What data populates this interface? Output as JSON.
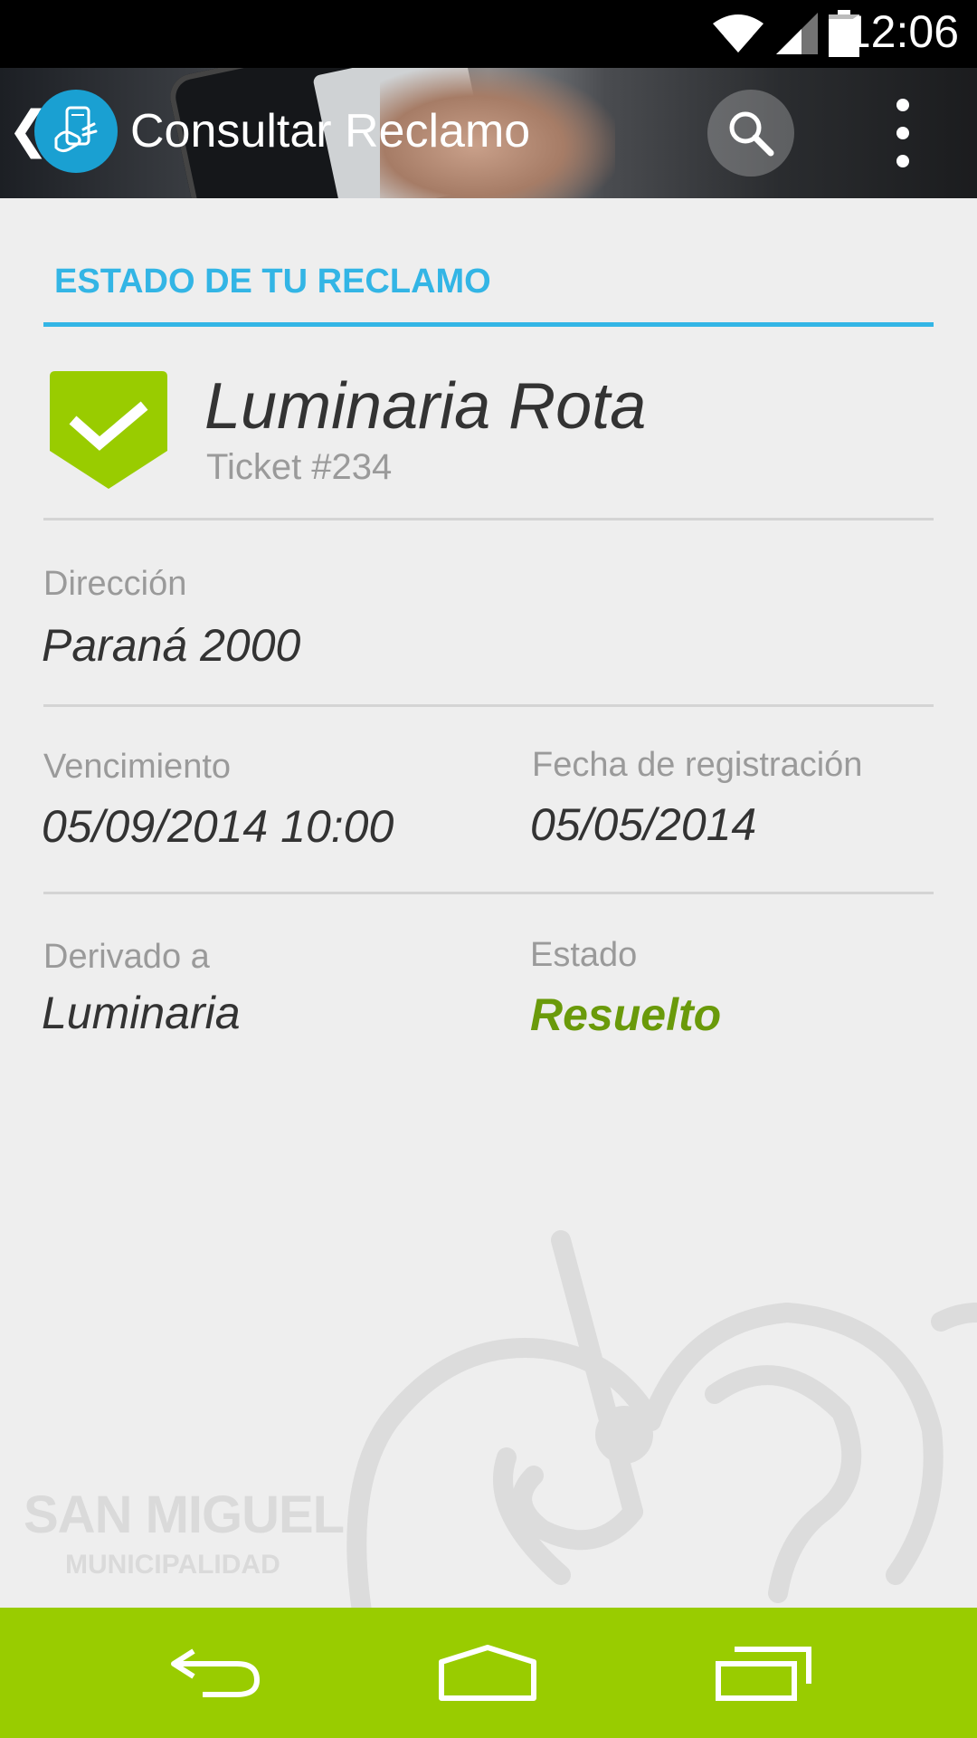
{
  "status_bar": {
    "time": "12:06",
    "icons": [
      "wifi-icon",
      "signal-icon",
      "battery-icon"
    ]
  },
  "action_bar": {
    "title": "Consultar Reclamo",
    "icons": [
      "back-chevron-icon",
      "app-logo-icon",
      "search-icon",
      "overflow-menu-icon"
    ]
  },
  "section": {
    "header": "ESTADO DE TU RECLAMO"
  },
  "claim": {
    "title": "Luminaria Rota",
    "ticket": "Ticket #234",
    "status_icon": "checkmark-icon"
  },
  "fields": {
    "direccion_label": "Dirección",
    "direccion_value": "Paraná 2000",
    "vencimiento_label": "Vencimiento",
    "vencimiento_value": "05/09/2014 10:00",
    "fecha_label": "Fecha de registración",
    "fecha_value": "05/05/2014",
    "derivado_label": "Derivado a",
    "derivado_value": "Luminaria",
    "estado_label": "Estado",
    "estado_value": "Resuelto"
  },
  "watermark": {
    "brand": "SAN MIGUEL",
    "subtitle": "MUNICIPALIDAD"
  },
  "nav_bar": {
    "buttons": [
      "back-nav-icon",
      "home-nav-icon",
      "recents-nav-icon"
    ]
  },
  "colors": {
    "accent_blue": "#33b5e5",
    "success_green": "#99cc00",
    "status_text_green": "#6a9a0a"
  }
}
